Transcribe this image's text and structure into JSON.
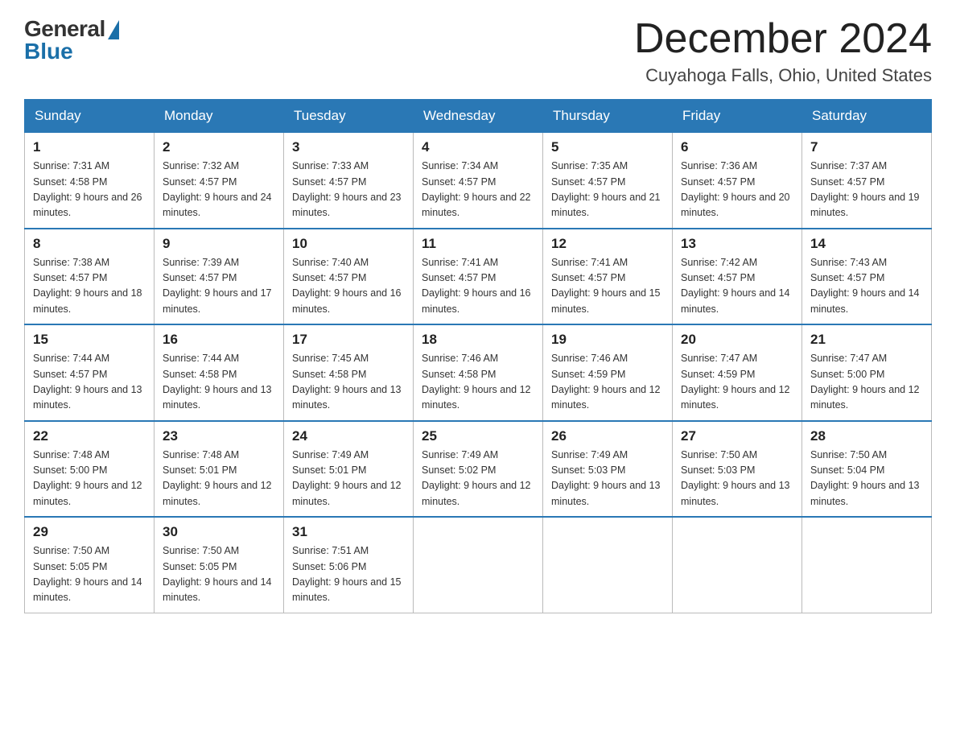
{
  "logo": {
    "general": "General",
    "blue": "Blue"
  },
  "header": {
    "month": "December 2024",
    "location": "Cuyahoga Falls, Ohio, United States"
  },
  "days_of_week": [
    "Sunday",
    "Monday",
    "Tuesday",
    "Wednesday",
    "Thursday",
    "Friday",
    "Saturday"
  ],
  "weeks": [
    [
      {
        "day": "1",
        "sunrise": "7:31 AM",
        "sunset": "4:58 PM",
        "daylight": "9 hours and 26 minutes."
      },
      {
        "day": "2",
        "sunrise": "7:32 AM",
        "sunset": "4:57 PM",
        "daylight": "9 hours and 24 minutes."
      },
      {
        "day": "3",
        "sunrise": "7:33 AM",
        "sunset": "4:57 PM",
        "daylight": "9 hours and 23 minutes."
      },
      {
        "day": "4",
        "sunrise": "7:34 AM",
        "sunset": "4:57 PM",
        "daylight": "9 hours and 22 minutes."
      },
      {
        "day": "5",
        "sunrise": "7:35 AM",
        "sunset": "4:57 PM",
        "daylight": "9 hours and 21 minutes."
      },
      {
        "day": "6",
        "sunrise": "7:36 AM",
        "sunset": "4:57 PM",
        "daylight": "9 hours and 20 minutes."
      },
      {
        "day": "7",
        "sunrise": "7:37 AM",
        "sunset": "4:57 PM",
        "daylight": "9 hours and 19 minutes."
      }
    ],
    [
      {
        "day": "8",
        "sunrise": "7:38 AM",
        "sunset": "4:57 PM",
        "daylight": "9 hours and 18 minutes."
      },
      {
        "day": "9",
        "sunrise": "7:39 AM",
        "sunset": "4:57 PM",
        "daylight": "9 hours and 17 minutes."
      },
      {
        "day": "10",
        "sunrise": "7:40 AM",
        "sunset": "4:57 PM",
        "daylight": "9 hours and 16 minutes."
      },
      {
        "day": "11",
        "sunrise": "7:41 AM",
        "sunset": "4:57 PM",
        "daylight": "9 hours and 16 minutes."
      },
      {
        "day": "12",
        "sunrise": "7:41 AM",
        "sunset": "4:57 PM",
        "daylight": "9 hours and 15 minutes."
      },
      {
        "day": "13",
        "sunrise": "7:42 AM",
        "sunset": "4:57 PM",
        "daylight": "9 hours and 14 minutes."
      },
      {
        "day": "14",
        "sunrise": "7:43 AM",
        "sunset": "4:57 PM",
        "daylight": "9 hours and 14 minutes."
      }
    ],
    [
      {
        "day": "15",
        "sunrise": "7:44 AM",
        "sunset": "4:57 PM",
        "daylight": "9 hours and 13 minutes."
      },
      {
        "day": "16",
        "sunrise": "7:44 AM",
        "sunset": "4:58 PM",
        "daylight": "9 hours and 13 minutes."
      },
      {
        "day": "17",
        "sunrise": "7:45 AM",
        "sunset": "4:58 PM",
        "daylight": "9 hours and 13 minutes."
      },
      {
        "day": "18",
        "sunrise": "7:46 AM",
        "sunset": "4:58 PM",
        "daylight": "9 hours and 12 minutes."
      },
      {
        "day": "19",
        "sunrise": "7:46 AM",
        "sunset": "4:59 PM",
        "daylight": "9 hours and 12 minutes."
      },
      {
        "day": "20",
        "sunrise": "7:47 AM",
        "sunset": "4:59 PM",
        "daylight": "9 hours and 12 minutes."
      },
      {
        "day": "21",
        "sunrise": "7:47 AM",
        "sunset": "5:00 PM",
        "daylight": "9 hours and 12 minutes."
      }
    ],
    [
      {
        "day": "22",
        "sunrise": "7:48 AM",
        "sunset": "5:00 PM",
        "daylight": "9 hours and 12 minutes."
      },
      {
        "day": "23",
        "sunrise": "7:48 AM",
        "sunset": "5:01 PM",
        "daylight": "9 hours and 12 minutes."
      },
      {
        "day": "24",
        "sunrise": "7:49 AM",
        "sunset": "5:01 PM",
        "daylight": "9 hours and 12 minutes."
      },
      {
        "day": "25",
        "sunrise": "7:49 AM",
        "sunset": "5:02 PM",
        "daylight": "9 hours and 12 minutes."
      },
      {
        "day": "26",
        "sunrise": "7:49 AM",
        "sunset": "5:03 PM",
        "daylight": "9 hours and 13 minutes."
      },
      {
        "day": "27",
        "sunrise": "7:50 AM",
        "sunset": "5:03 PM",
        "daylight": "9 hours and 13 minutes."
      },
      {
        "day": "28",
        "sunrise": "7:50 AM",
        "sunset": "5:04 PM",
        "daylight": "9 hours and 13 minutes."
      }
    ],
    [
      {
        "day": "29",
        "sunrise": "7:50 AM",
        "sunset": "5:05 PM",
        "daylight": "9 hours and 14 minutes."
      },
      {
        "day": "30",
        "sunrise": "7:50 AM",
        "sunset": "5:05 PM",
        "daylight": "9 hours and 14 minutes."
      },
      {
        "day": "31",
        "sunrise": "7:51 AM",
        "sunset": "5:06 PM",
        "daylight": "9 hours and 15 minutes."
      },
      null,
      null,
      null,
      null
    ]
  ],
  "labels": {
    "sunrise_prefix": "Sunrise: ",
    "sunset_prefix": "Sunset: ",
    "daylight_prefix": "Daylight: "
  }
}
